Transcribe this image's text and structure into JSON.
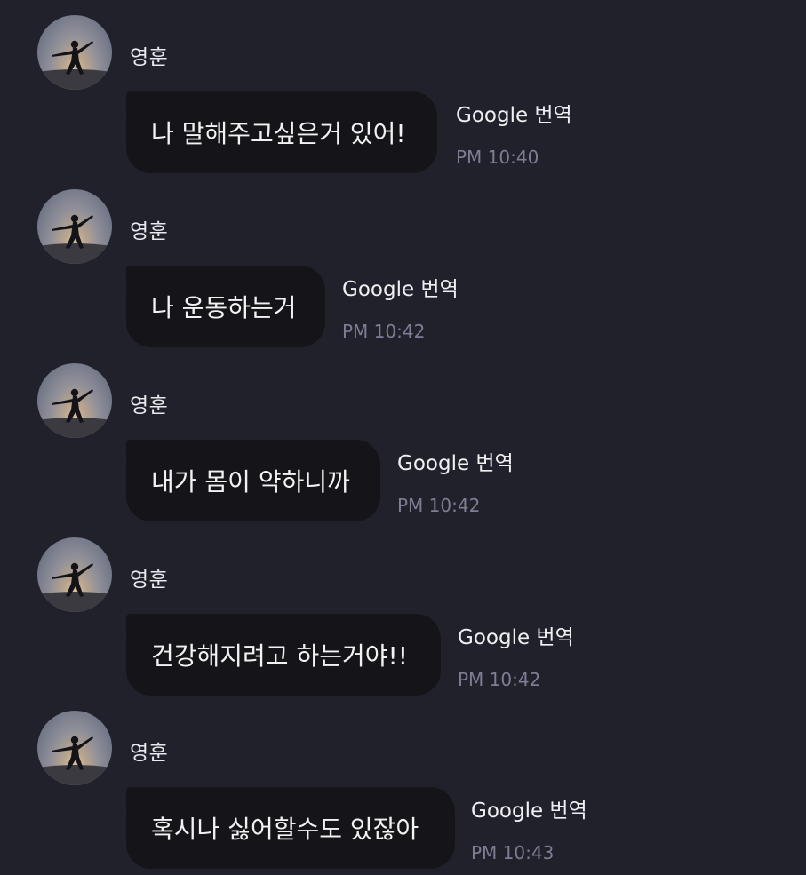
{
  "messages": [
    {
      "sender": "영훈",
      "text": "나 말해주고싶은거 있어!",
      "action": "Google 번역",
      "time": "PM 10:40"
    },
    {
      "sender": "영훈",
      "text": "나 운동하는거",
      "action": "Google 번역",
      "time": "PM 10:42"
    },
    {
      "sender": "영훈",
      "text": "내가 몸이 약하니까",
      "action": "Google 번역",
      "time": "PM 10:42"
    },
    {
      "sender": "영훈",
      "text": "건강해지려고 하는거야!!",
      "action": "Google 번역",
      "time": "PM 10:42"
    },
    {
      "sender": "영훈",
      "text": "혹시나 싫어할수도 있잖아",
      "action": "Google 번역",
      "time": "PM 10:43"
    }
  ],
  "colors": {
    "background": "#21212b",
    "bubble": "#151519",
    "timestamp": "#7d7d93"
  }
}
